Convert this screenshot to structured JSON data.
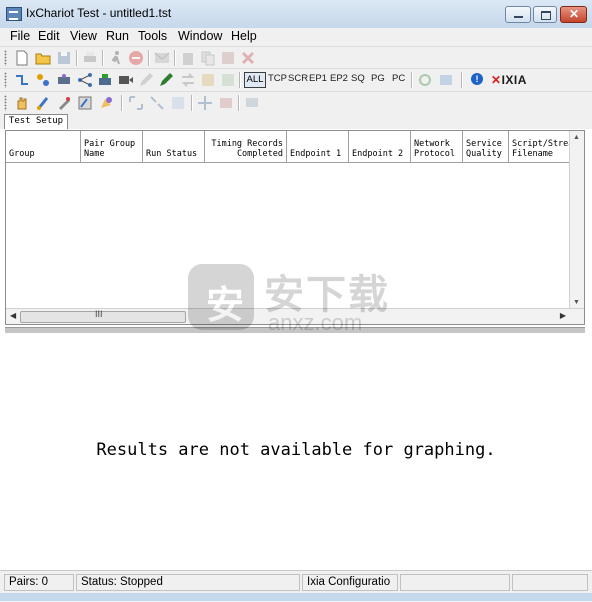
{
  "window": {
    "title": "IxChariot Test - untitled1.tst"
  },
  "menu": [
    {
      "label": "File"
    },
    {
      "label": "Edit"
    },
    {
      "label": "View"
    },
    {
      "label": "Run"
    },
    {
      "label": "Tools"
    },
    {
      "label": "Window"
    },
    {
      "label": "Help"
    }
  ],
  "toolbar_filters": {
    "all": "ALL",
    "items": [
      "TCP",
      "SCR",
      "EP1",
      "EP2",
      "SQ",
      "PG",
      "PC"
    ]
  },
  "brand": {
    "logo_text": "IXIA",
    "accent": "#d4211e"
  },
  "tabs": [
    {
      "label": "Test Setup"
    }
  ],
  "grid": {
    "columns": [
      {
        "label": "Group"
      },
      {
        "label": "Pair Group\nName"
      },
      {
        "label": "Run Status"
      },
      {
        "label": "Timing Records\nCompleted"
      },
      {
        "label": "Endpoint 1"
      },
      {
        "label": "Endpoint 2"
      },
      {
        "label": "Network\nProtocol"
      },
      {
        "label": "Service\nQuality"
      },
      {
        "label": "Script/Stream\nFilename"
      }
    ],
    "rows": []
  },
  "hscroll_thumb_label": "III",
  "results": {
    "message": "Results are not available for graphing."
  },
  "status": {
    "pairs": "Pairs: 0",
    "run_status": "Status: Stopped",
    "config": "Ixia Configuratio"
  },
  "watermark": {
    "text": "安下载",
    "sub": "anxz.com",
    "icon_char": "安"
  }
}
